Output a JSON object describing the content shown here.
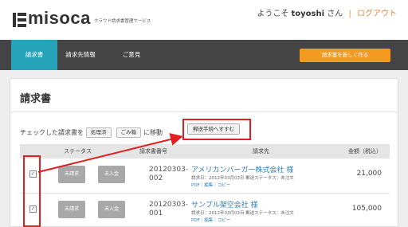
{
  "header": {
    "logo_text": "misoca",
    "tagline": "クラウド請求書管理サービス",
    "welcome_prefix": "ようこそ",
    "username": "toyoshi",
    "welcome_suffix": "さん",
    "separator": "|",
    "logout_label": "ログアウト"
  },
  "nav": {
    "tabs": [
      {
        "label": "請求書",
        "active": true
      },
      {
        "label": "請求先情報",
        "active": false
      },
      {
        "label": "ご意見",
        "active": false
      }
    ],
    "new_invoice_label": "請求書を新しく作る",
    "accent_color": "#26a3b8",
    "button_color": "#f39a21"
  },
  "page": {
    "title": "請求書",
    "action_prefix": "チェックした請求書を",
    "action_processed": "処理済",
    "action_trash": "ごみ箱",
    "action_move_suffix": "に移動",
    "send_button": "郵送手続へすすむ"
  },
  "table": {
    "headers": [
      "ステータス",
      "請求書番号",
      "請求先",
      "金額（税込）"
    ],
    "rows": [
      {
        "checked": true,
        "status": "未請求",
        "payment": "未入金",
        "number": "20120303-002",
        "client": "アメリカンバーガー株式会社 様",
        "meta": "請求日：2012年03月03日 郵送ステータス：未注文",
        "links": "PDF｜編集｜コピー",
        "amount": "21,000"
      },
      {
        "checked": true,
        "status": "未請求",
        "payment": "未入金",
        "number": "20120303-001",
        "client": "サンプル架空会社 様",
        "meta": "請求日：2012年03月03日 郵送ステータス：未注文",
        "links": "PDF｜編集｜コピー",
        "amount": "105,000"
      }
    ]
  },
  "annotation_color": "#e02020"
}
